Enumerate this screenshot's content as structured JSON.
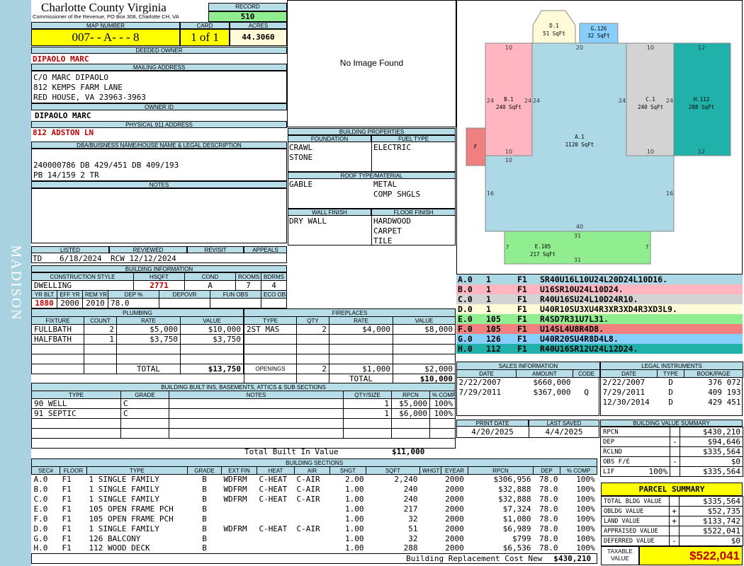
{
  "side_label": "MADISON",
  "header": {
    "county": "Charlotte County Virginia",
    "commissioner": "Commissioner of the Revenue, PO Box 308, Charlotte CH, VA"
  },
  "record": {
    "label": "RECORD",
    "value": "510"
  },
  "map": {
    "map_label": "MAP NUMBER",
    "map_number": "007- - A- - - 8",
    "card_label": "CARD",
    "card": "1 of 1",
    "acres_label": "ACRES",
    "acres": "44.3060"
  },
  "owner": {
    "deeded_label": "DEEDED OWNER",
    "deeded": "DIPAOLO MARC",
    "mailing_label": "MAILING ADDRESS",
    "mail1": "C/O MARC DIPAOLO",
    "mail2": "812 KEMPS FARM LANE",
    "mail3": "RED HOUSE, VA 23963-3963",
    "id_label": "OWNER ID",
    "id": "DIPAOLO MARC",
    "phys_label": "PHYSICAL 911 ADDRESS",
    "phys": "812 ADSTON LN"
  },
  "legal": {
    "label": "DBA/BUISNESS NAME/HOUSE NAME & LEGAL DESCRIPTION",
    "line1": "240000786 DB 429/451 DB 409/193",
    "line2": "PB 14/159 2 TR",
    "notes_label": "NOTES"
  },
  "image": {
    "placeholder": "No Image Found"
  },
  "props": {
    "label": "BUILDING PROPERTIES",
    "foundation_label": "FOUNDATION",
    "foundation": [
      "CRAWL",
      "STONE"
    ],
    "fuel_label": "FUEL TYPE",
    "fuel": [
      "ELECTRIC"
    ],
    "roof_label": "ROOF TYPE/MATERIAL",
    "roof_type": [
      "GABLE"
    ],
    "roof_mat": [
      "METAL",
      "COMP SHGLS"
    ],
    "wall_label": "WALL FINISH",
    "wall": [
      "DRY WALL"
    ],
    "floor_label": "FLOOR FINISH",
    "floor": [
      "HARDWOOD",
      "CARPET",
      "TILE"
    ]
  },
  "dates": {
    "listed_label": "LISTED",
    "listed_code": "TD",
    "listed": "6/18/2024",
    "reviewed_label": "REVIEWED",
    "reviewed": "RCW 12/12/2024",
    "revisit_label": "REVISIT",
    "appeals_label": "APPEALS"
  },
  "building": {
    "label": "BUILDING INFORMATION",
    "style_label": "CONSTRUCTION STYLE",
    "style": "DWELLING",
    "hsqft_label": "HSQFT",
    "hsqft": "2771",
    "cond_label": "COND",
    "cond": "A",
    "rooms_label": "ROOMS",
    "rooms": "7",
    "bdrms_label": "BDRMS",
    "bdrms": "4",
    "yrblt_label": "YR BLT",
    "yrblt": "1880",
    "effyr_label": "EFF YR",
    "effyr": "2000",
    "remyr_label": "REM YR",
    "remyr": "2010",
    "dep_label": "DEP %",
    "dep": "78.0",
    "depovr_label": "DEPOVR",
    "funobs_label": "FUN OBS",
    "ecoobs_label": "ECO OBS"
  },
  "plumbing": {
    "label": "PLUMBING",
    "cols": [
      "FIXTURE",
      "COUNT",
      "RATE",
      "VALUE"
    ],
    "rows": [
      [
        "FULLBATH",
        "2",
        "$5,000",
        "$10,000"
      ],
      [
        "HALFBATH",
        "1",
        "$3,750",
        "$3,750"
      ]
    ],
    "total_label": "TOTAL",
    "total": "$13,750"
  },
  "fireplaces": {
    "label": "FIREPLACES",
    "cols": [
      "TYPE",
      "QTY",
      "RATE",
      "VALUE"
    ],
    "rows": [
      [
        "2ST MAS",
        "2",
        "$4,000",
        "$8,000"
      ]
    ],
    "openings_label": "OPENINGS",
    "openings_qty": "2",
    "openings_rate": "$1,000",
    "openings_value": "$2,000",
    "total_label": "TOTAL",
    "total": "$10,000"
  },
  "builtins": {
    "label": "BUILDING BUILT INS, BASEMENTS, ATTICS & SUB SECTIONS",
    "cols": [
      "TYPE",
      "GRADE",
      "NOTES",
      "QTY/SIZE",
      "RPCN",
      "% COMP"
    ],
    "rows": [
      [
        "90 WELL",
        "C",
        "",
        "1",
        "$5,000",
        "100%"
      ],
      [
        "91 SEPTIC",
        "C",
        "",
        "1",
        "$6,000",
        "100%"
      ]
    ],
    "total_label": "Total Built In Value",
    "total": "$11,000"
  },
  "sections": {
    "label": "BUILDING SECTIONS",
    "cols": [
      "SEC#",
      "FLOOR",
      "TYPE",
      "GRADE",
      "EXT FIN",
      "HEAT",
      "AIR",
      "SHGT",
      "SQFT",
      "WHGT",
      "EYEAR",
      "RPCN",
      "DEP",
      "% COMP"
    ],
    "rows": [
      [
        "A.0",
        "F1",
        "1 SINGLE FAMILY",
        "B",
        "WDFRM",
        "C-HEAT",
        "C-AIR",
        "2.00",
        "2,240",
        "",
        "2000",
        "$306,956",
        "78.0",
        "100%"
      ],
      [
        "B.0",
        "F1",
        "1 SINGLE FAMILY",
        "B",
        "WDFRM",
        "C-HEAT",
        "C-AIR",
        "1.00",
        "240",
        "",
        "2000",
        "$32,888",
        "78.0",
        "100%"
      ],
      [
        "C.0",
        "F1",
        "1 SINGLE FAMILY",
        "B",
        "WDFRM",
        "C-HEAT",
        "C-AIR",
        "1.00",
        "240",
        "",
        "2000",
        "$32,888",
        "78.0",
        "100%"
      ],
      [
        "E.0",
        "F1",
        "105 OPEN FRAME PCH",
        "B",
        "",
        "",
        "",
        "1.00",
        "217",
        "",
        "2000",
        "$7,324",
        "78.0",
        "100%"
      ],
      [
        "F.0",
        "F1",
        "105 OPEN FRAME PCH",
        "B",
        "",
        "",
        "",
        "1.00",
        "32",
        "",
        "2000",
        "$1,080",
        "78.0",
        "100%"
      ],
      [
        "D.0",
        "F1",
        "1 SINGLE FAMILY",
        "B",
        "WDFRM",
        "C-HEAT",
        "C-AIR",
        "1.00",
        "51",
        "",
        "2000",
        "$6,989",
        "78.0",
        "100%"
      ],
      [
        "G.0",
        "F1",
        "126 BALCONY",
        "B",
        "",
        "",
        "",
        "1.00",
        "32",
        "",
        "2000",
        "$799",
        "78.0",
        "100%"
      ],
      [
        "H.0",
        "F1",
        "112 WOOD DECK",
        "B",
        "",
        "",
        "",
        "1.00",
        "288",
        "",
        "2000",
        "$6,536",
        "78.0",
        "100%"
      ]
    ],
    "total_label": "Building Replacement Cost New",
    "total": "$430,210"
  },
  "sketch": {
    "labels": {
      "d": {
        "name": "D.1",
        "area": "51 SqFt"
      },
      "g": {
        "name": "G.126",
        "area": "32 SqFt"
      },
      "b": {
        "name": "B.1",
        "area": "240 SqFt"
      },
      "c": {
        "name": "C.1",
        "area": "240 SqFt"
      },
      "h": {
        "name": "H.112",
        "area": "288 SqFt"
      },
      "a": {
        "name": "A.1",
        "area": "1120 SqFt"
      },
      "e": {
        "name": "E.105",
        "area": "217 SqFt"
      },
      "f": {
        "name": "F"
      }
    },
    "dims": {
      "d10a": "10",
      "d20": "20",
      "d10b": "10",
      "d12a": "12",
      "d24a": "24",
      "d24b": "24",
      "d24c": "24",
      "d24d": "24",
      "d24e": "24",
      "d10c": "10",
      "d10d": "10",
      "d10e": "10",
      "d12b": "12",
      "d16a": "16",
      "d16b": "16",
      "d40": "40",
      "d31a": "31",
      "d7a": "7",
      "d7b": "7",
      "d31b": "31"
    },
    "colors": {
      "a": "#add8e6",
      "b": "#ffb6c1",
      "c": "#d3d3d3",
      "d": "#fffad7",
      "e": "#90ee90",
      "f": "#f08080",
      "g": "#87cefa",
      "h": "#20b2aa"
    }
  },
  "segments": [
    {
      "code": "A.0",
      "num": "1",
      "floor": "F1",
      "path": "SR40U16L10U24L20D24L10D16.",
      "bg": "#add8e6"
    },
    {
      "code": "B.0",
      "num": "1",
      "floor": "F1",
      "path": "U16SR10U24L10D24.",
      "bg": "#ffb6c1"
    },
    {
      "code": "C.0",
      "num": "1",
      "floor": "F1",
      "path": "R40U16SU24L10D24R10.",
      "bg": "#d3d3d3"
    },
    {
      "code": "D.0",
      "num": "1",
      "floor": "F1",
      "path": "U40R10SU3XU4R3XR3XD4R3XD3L9.",
      "bg": "#fffad7"
    },
    {
      "code": "E.0",
      "num": "105",
      "floor": "F1",
      "path": "R4SD7R31U7L31.",
      "bg": "#90ee90"
    },
    {
      "code": "F.0",
      "num": "105",
      "floor": "F1",
      "path": "U14SL4U8R4D8.",
      "bg": "#f08080"
    },
    {
      "code": "G.0",
      "num": "126",
      "floor": "F1",
      "path": "U40R20SU4R8D4L8.",
      "bg": "#87cefa"
    },
    {
      "code": "H.0",
      "num": "112",
      "floor": "F1",
      "path": "R40U16SR12U24L12D24.",
      "bg": "#20b2aa"
    }
  ],
  "sales": {
    "label": "SALES INFORMATION",
    "cols": [
      "DATE",
      "AMOUNT",
      "CODE"
    ],
    "rows": [
      [
        "2/22/2007",
        "$660,000",
        ""
      ],
      [
        "7/29/2011",
        "$367,000",
        "Q"
      ]
    ]
  },
  "legal_instr": {
    "label": "LEGAL INSTRUMENTS",
    "cols": [
      "DATE",
      "TYPE",
      "BOOK/PAGE"
    ],
    "rows": [
      [
        "2/22/2007",
        "D",
        "376 072"
      ],
      [
        "7/29/2011",
        "D",
        "409 193"
      ],
      [
        "12/30/2014",
        "D",
        "429 451"
      ]
    ]
  },
  "print": {
    "print_label": "PRINT DATE",
    "print": "4/20/2025",
    "saved_label": "LAST SAVED",
    "saved": "4/4/2025"
  },
  "bvs": {
    "label": "BUILDING VALUE SUMMARY",
    "rows": [
      {
        "k": "RPCN",
        "s": "",
        "v": "$430,210"
      },
      {
        "k": "DEP",
        "s": "-",
        "v": "$94,646"
      },
      {
        "k": "RCLND",
        "s": "",
        "v": "$335,564"
      },
      {
        "k": "OBS F/E",
        "s": "-",
        "v": "$0"
      },
      {
        "k": "LIF",
        "pct": "100%",
        "s": "",
        "v": "$335,564"
      }
    ]
  },
  "parcel": {
    "label": "PARCEL SUMMARY",
    "rows": [
      {
        "k": "TOTAL BLDG VALUE",
        "s": "",
        "v": "$335,564"
      },
      {
        "k": "OBLDG VALUE",
        "s": "+",
        "v": "$52,735"
      },
      {
        "k": "LAND VALUE",
        "s": "+",
        "v": "$133,742"
      },
      {
        "k": "APPRAISED VALUE",
        "s": "",
        "v": "$522,041"
      },
      {
        "k": "DEFERRED VALUE",
        "s": "-",
        "v": "$0"
      }
    ],
    "taxable_label": "TAXABLE VALUE",
    "taxable": "$522,041"
  }
}
